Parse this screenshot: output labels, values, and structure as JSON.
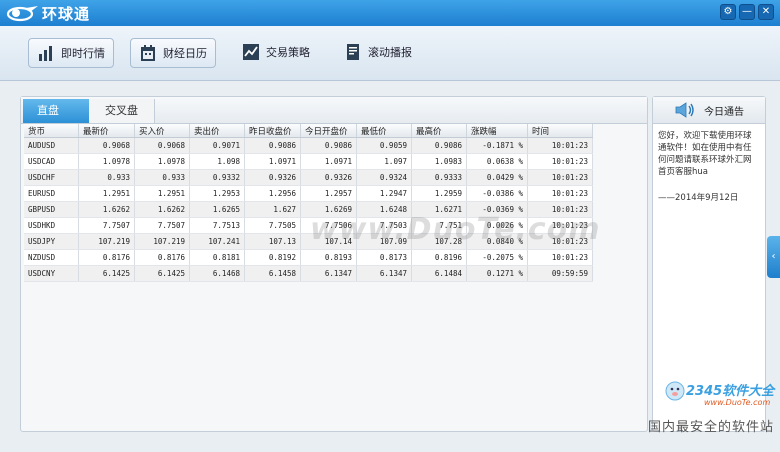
{
  "app": {
    "title": "环球通"
  },
  "window_controls": {
    "settings": "⚙",
    "minimize": "—",
    "close": "✕"
  },
  "toolbar": {
    "items": [
      {
        "label": "即时行情",
        "icon": "bar-chart-icon"
      },
      {
        "label": "财经日历",
        "icon": "calendar-icon"
      },
      {
        "label": "交易策略",
        "icon": "trend-line-icon"
      },
      {
        "label": "滚动播报",
        "icon": "document-icon"
      }
    ]
  },
  "tabs": {
    "active": "直盘",
    "inactive": "交叉盘"
  },
  "table": {
    "headers": [
      "货币",
      "最新价",
      "买入价",
      "卖出价",
      "昨日收盘价",
      "今日开盘价",
      "最低价",
      "最高价",
      "涨跌幅",
      "时间"
    ],
    "rows": [
      [
        "AUDUSD",
        "0.9068",
        "0.9068",
        "0.9071",
        "0.9086",
        "0.9086",
        "0.9059",
        "0.9086",
        "-0.1871 %",
        "10:01:23"
      ],
      [
        "USDCAD",
        "1.0978",
        "1.0978",
        "1.098",
        "1.0971",
        "1.0971",
        "1.097",
        "1.0983",
        "0.0638 %",
        "10:01:23"
      ],
      [
        "USDCHF",
        "0.933",
        "0.933",
        "0.9332",
        "0.9326",
        "0.9326",
        "0.9324",
        "0.9333",
        "0.0429 %",
        "10:01:23"
      ],
      [
        "EURUSD",
        "1.2951",
        "1.2951",
        "1.2953",
        "1.2956",
        "1.2957",
        "1.2947",
        "1.2959",
        "-0.0386 %",
        "10:01:23"
      ],
      [
        "GBPUSD",
        "1.6262",
        "1.6262",
        "1.6265",
        "1.627",
        "1.6269",
        "1.6248",
        "1.6271",
        "-0.0369 %",
        "10:01:23"
      ],
      [
        "USDHKD",
        "7.7507",
        "7.7507",
        "7.7513",
        "7.7505",
        "7.7506",
        "7.7503",
        "7.751",
        "0.0026 %",
        "10:01:23"
      ],
      [
        "USDJPY",
        "107.219",
        "107.219",
        "107.241",
        "107.13",
        "107.14",
        "107.09",
        "107.28",
        "0.0840 %",
        "10:01:23"
      ],
      [
        "NZDUSD",
        "0.8176",
        "0.8176",
        "0.8181",
        "0.8192",
        "0.8193",
        "0.8173",
        "0.8196",
        "-0.2075 %",
        "10:01:23"
      ],
      [
        "USDCNY",
        "6.1425",
        "6.1425",
        "6.1468",
        "6.1458",
        "6.1347",
        "6.1347",
        "6.1484",
        "0.1271 %",
        "09:59:59"
      ]
    ]
  },
  "notice": {
    "title": "今日通告",
    "body": "您好，欢迎下载使用环球通软件！如在使用中有任何问题请联系环球外汇网首页客服hua",
    "date": "——2014年9月12日"
  },
  "watermarks": {
    "center": "www.DuoTe.com",
    "site": "2345软件大全",
    "url": "www.DuoTe.com",
    "slogan": "国内最安全的软件站"
  },
  "colors": {
    "titlebar": "#1d7fd0",
    "tab_active": "#2d90d6"
  }
}
